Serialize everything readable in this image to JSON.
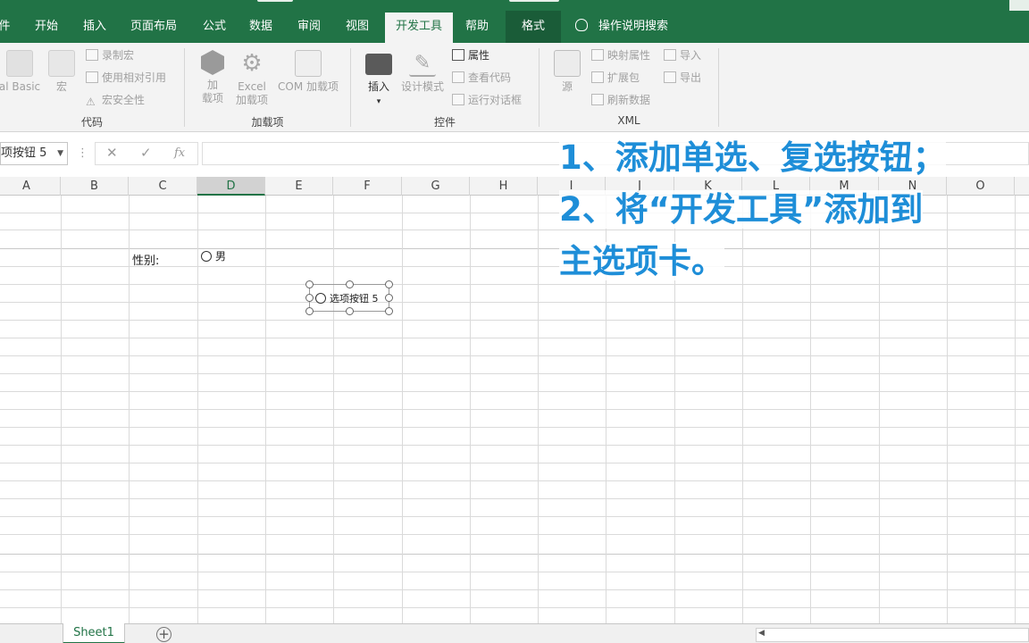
{
  "ribbon_tabs": [
    {
      "label": "件"
    },
    {
      "label": "开始"
    },
    {
      "label": "插入"
    },
    {
      "label": "页面布局"
    },
    {
      "label": "公式"
    },
    {
      "label": "数据"
    },
    {
      "label": "审阅"
    },
    {
      "label": "视图"
    },
    {
      "label": "开发工具"
    },
    {
      "label": "帮助"
    },
    {
      "label": "格式"
    }
  ],
  "tell_me": "操作说明搜索",
  "groups": {
    "code": {
      "label": "代码",
      "vb": "al Basic",
      "macros": "宏",
      "record_macro": "录制宏",
      "relative_ref": "使用相对引用",
      "macro_security": "宏安全性"
    },
    "addins": {
      "label": "加载项",
      "addins_line1": "加",
      "addins_line2": "载项",
      "excel_line1": "Excel",
      "excel_line2": "加载项",
      "com": "COM 加载项"
    },
    "controls": {
      "label": "控件",
      "insert": "插入",
      "design_mode": "设计模式",
      "properties": "属性",
      "view_code": "查看代码",
      "run_dialog": "运行对话框"
    },
    "xml": {
      "label": "XML",
      "source": "源",
      "map_properties": "映射属性",
      "expansion_packs": "扩展包",
      "refresh_data": "刷新数据",
      "import": "导入",
      "export": "导出"
    }
  },
  "formula_bar": {
    "name_box": "项按钮 5",
    "cancel": "✕",
    "enter": "✓",
    "fx": "fx",
    "value": ""
  },
  "columns": [
    "A",
    "B",
    "C",
    "D",
    "E",
    "F",
    "G",
    "H",
    "I",
    "J",
    "K",
    "L",
    "M",
    "N",
    "O"
  ],
  "cells": {
    "gender_label": "性别:",
    "radio_male": "男",
    "radio_new": "选项按钮 5"
  },
  "annotation": {
    "line1": "1、添加单选、复选按钮；",
    "line2": "2、将“开发工具”添加到",
    "line3": "主选项卡。"
  },
  "sheet": {
    "tab": "Sheet1",
    "add": "+"
  },
  "colors": {
    "ribbon_green": "#217346",
    "annotation_blue": "#1e8ed8"
  }
}
